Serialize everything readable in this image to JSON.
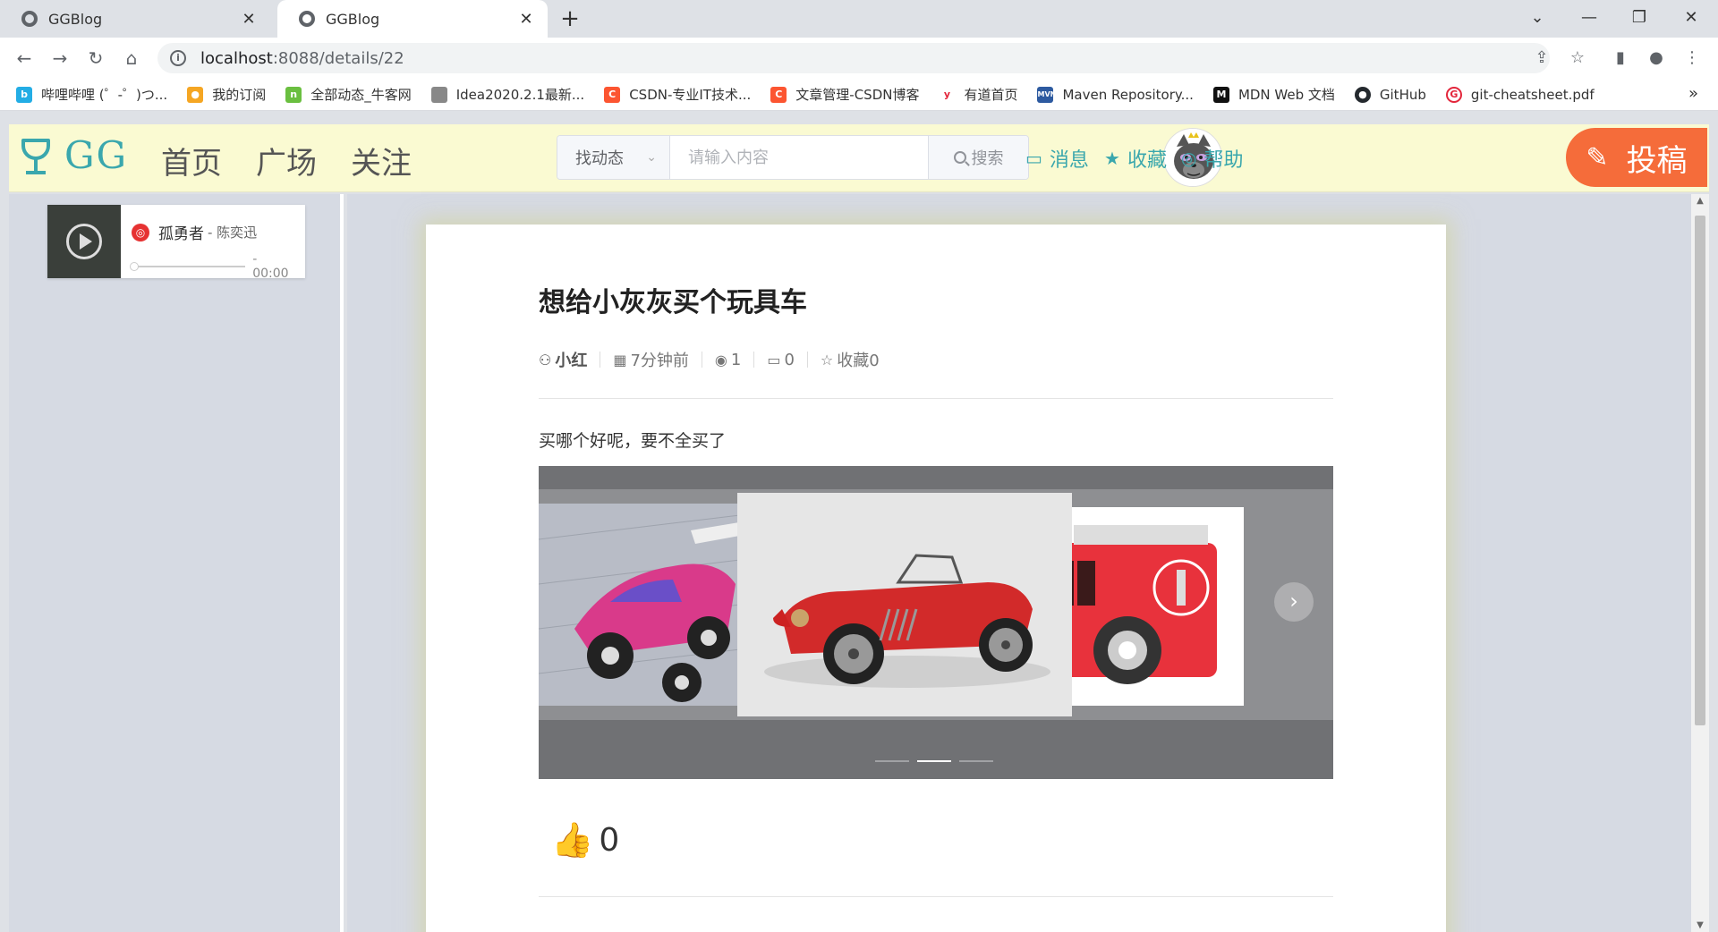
{
  "browser": {
    "tabs": [
      {
        "title": "GGBlog",
        "active": false
      },
      {
        "title": "GGBlog",
        "active": true
      }
    ],
    "url_host": "localhost",
    "url_path": ":8088/details/22",
    "bookmarks": [
      {
        "label": "哔哩哔哩 (゜-゜)つ...",
        "color": "#23ade5",
        "icon": "bilibili-icon"
      },
      {
        "label": "我的订阅",
        "color": "#f5a623",
        "icon": "subscription-icon"
      },
      {
        "label": "全部动态_牛客网",
        "color": "#6abf40",
        "icon": "nowcoder-icon"
      },
      {
        "label": "Idea2020.2.1最新...",
        "color": "#888888",
        "icon": "idea-icon"
      },
      {
        "label": "CSDN-专业IT技术...",
        "color": "#fc5531",
        "icon": "csdn-icon"
      },
      {
        "label": "文章管理-CSDN博客",
        "color": "#fc5531",
        "icon": "csdn-icon"
      },
      {
        "label": "有道首页",
        "color": "#e3263b",
        "icon": "youdao-icon"
      },
      {
        "label": "Maven Repository...",
        "color": "#2d5aa0",
        "icon": "maven-icon"
      },
      {
        "label": "MDN Web 文档",
        "color": "#111111",
        "icon": "mdn-icon"
      },
      {
        "label": "GitHub",
        "color": "#24292e",
        "icon": "github-icon"
      },
      {
        "label": "git-cheatsheet.pdf",
        "color": "#e3263b",
        "icon": "google-icon"
      }
    ]
  },
  "header": {
    "logo_text": "GG",
    "nav": [
      "首页",
      "广场",
      "关注"
    ],
    "search_select": "找动态",
    "search_placeholder": "请输入内容",
    "search_button": "搜索",
    "messages": "消息",
    "favorites": "收藏",
    "help": "帮助",
    "post": "投稿"
  },
  "player": {
    "song": "孤勇者",
    "artist": "- 陈奕迅",
    "time": "- 00:00"
  },
  "article": {
    "title": "想给小灰灰买个玩具车",
    "author": "小红",
    "time": "7分钟前",
    "views": "1",
    "comments": "0",
    "favorites": "收藏0",
    "body": "买哪个好呢，要不全买了",
    "likes": "0",
    "carousel_active_index": 1,
    "carousel_count": 3
  }
}
